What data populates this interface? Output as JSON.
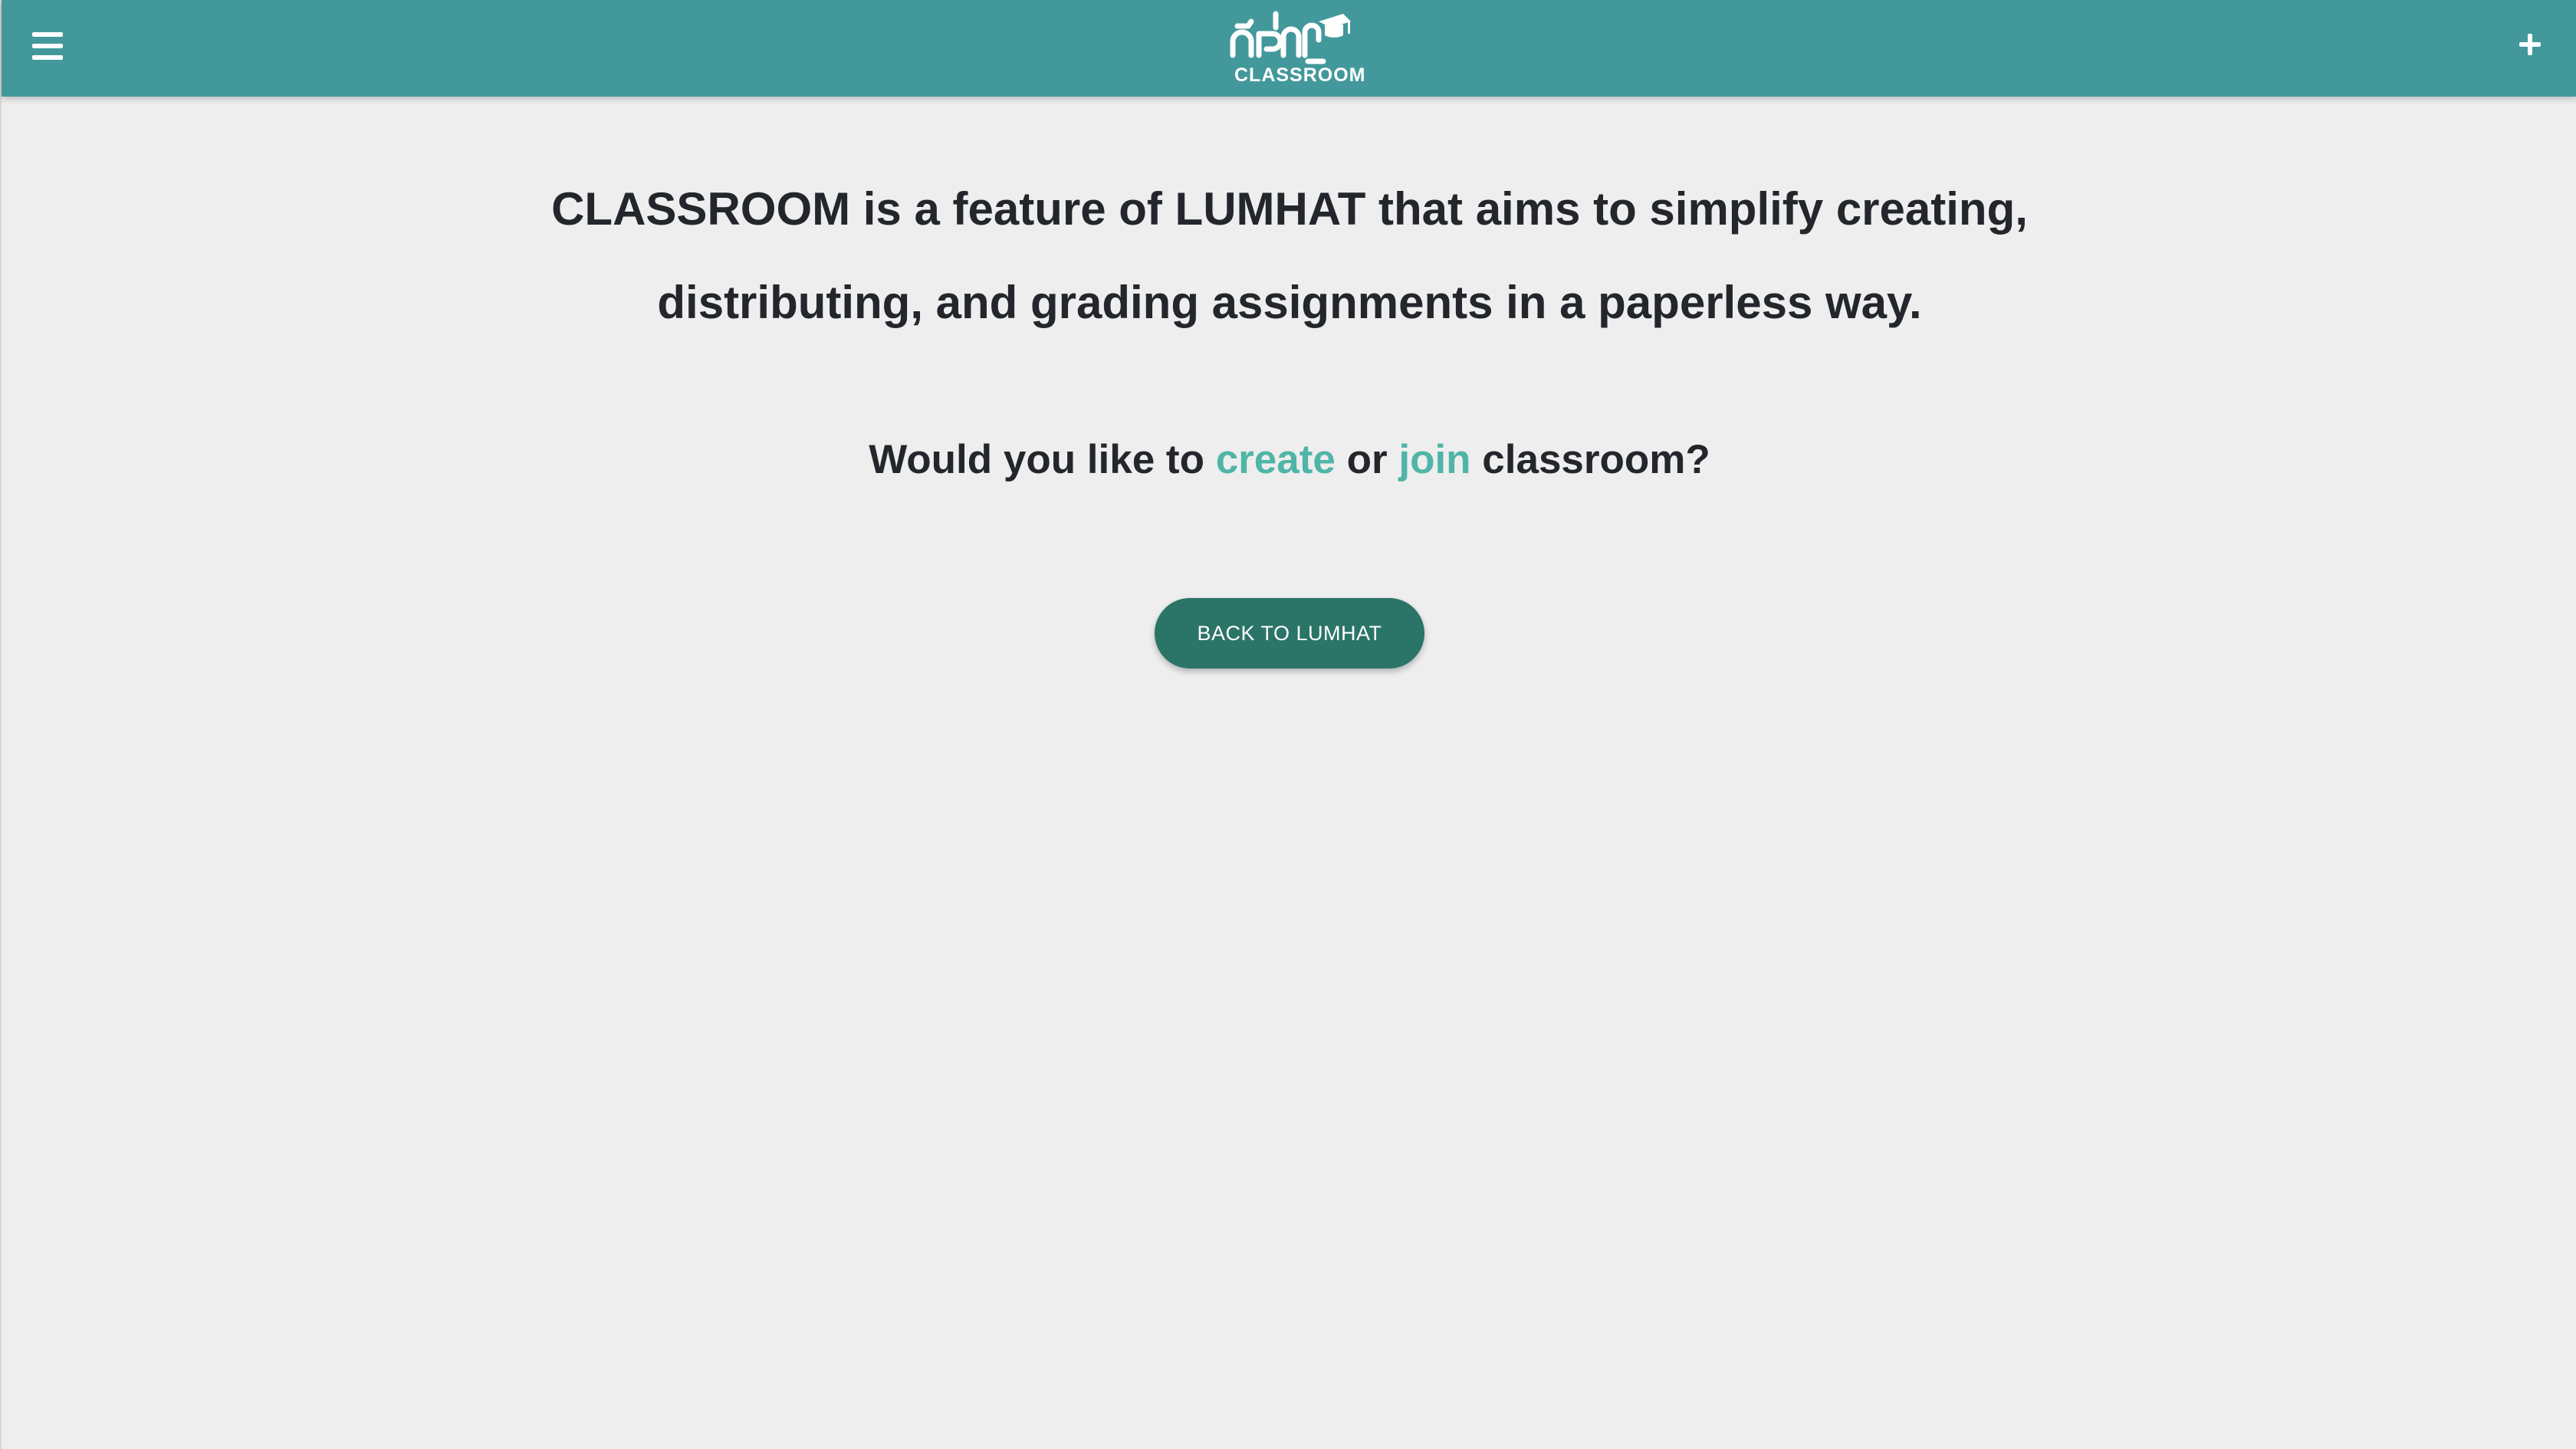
{
  "header": {
    "logo_text": "CLASSROOM",
    "logo_khmer": "ថ្នាក់រៀន",
    "menu_icon": "hamburger-menu-icon",
    "add_icon": "plus-icon",
    "background_color": "#42989b"
  },
  "main": {
    "intro_line1": "CLASSROOM is a feature of LUMHAT that aims to simplify creating,",
    "intro_line2": "distributing, and grading assignments in a paperless way.",
    "question_prefix": "Would you like to",
    "create_link": "create",
    "question_or": "or",
    "join_link": "join",
    "question_suffix": "classroom?",
    "back_button": "BACK TO LUMHAT"
  },
  "colors": {
    "link": "#4fb5a7",
    "button": "#2b7468",
    "text": "#23262b",
    "page_background": "#eeeeee"
  }
}
